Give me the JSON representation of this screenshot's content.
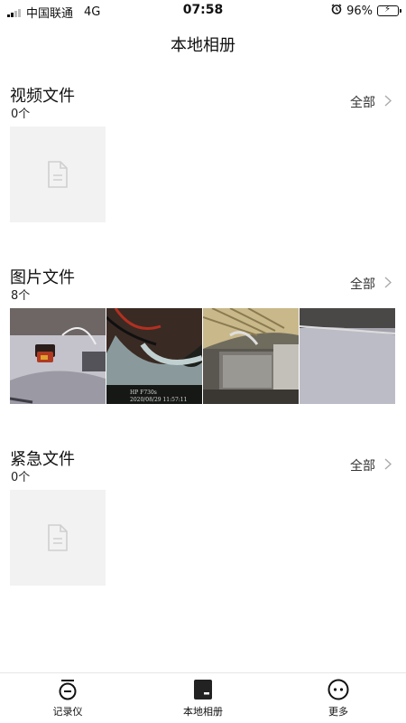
{
  "status_bar": {
    "carrier": "中国联通",
    "network": "4G",
    "time": "07:58",
    "battery": "96%"
  },
  "header": {
    "title": "本地相册"
  },
  "sections": [
    {
      "title": "视频文件",
      "count": "0个",
      "all_label": "全部"
    },
    {
      "title": "图片文件",
      "count": "8个",
      "all_label": "全部",
      "thumb_overlay": {
        "line1": "HP F730s",
        "line2": "2020/08/29 11:57:11"
      }
    },
    {
      "title": "紧急文件",
      "count": "0个",
      "all_label": "全部"
    }
  ],
  "tabbar": {
    "items": [
      {
        "label": "记录仪",
        "icon": "dashcam-icon"
      },
      {
        "label": "本地相册",
        "icon": "album-icon"
      },
      {
        "label": "更多",
        "icon": "more-icon"
      }
    ]
  },
  "colors": {
    "battery": "#f5c518",
    "placeholder_bg": "#f2f2f2"
  }
}
